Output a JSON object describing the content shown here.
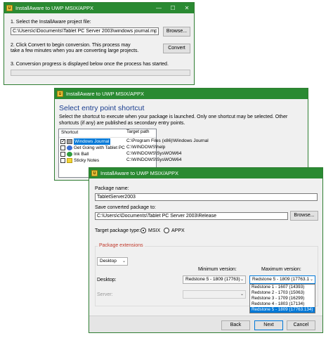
{
  "window1": {
    "title": "InstallAware to UWP MSIX/APPX",
    "step1_label": "1. Select the InstallAware project file:",
    "project_path": "C:\\Users\\c\\Documents\\Tablet PC Server 2003\\windows journal.mpr",
    "browse_label": "Browse...",
    "step2_label_line1": "2. Click Convert to begin conversion. This process may",
    "step2_label_line2": "take a few minutes when you are converting large projects.",
    "convert_label": "Convert",
    "step3_label": "3. Conversion progress is displayed below once the process has started.",
    "progress": 0
  },
  "window2": {
    "title": "InstallAware to UWP MSIX/APPX",
    "heading": "Select entry point shortcut",
    "desc_line1": "Select the shortcut to execute when your package is launched. Only one shortcut may be selected. Other",
    "desc_line2": "shortcuts (if any) are published as secondary entry points.",
    "columns": [
      "Shortcut",
      "Target path"
    ],
    "rows": [
      {
        "name": "Windows Journal",
        "path": "C:\\Program Files (x86)\\Windows Journal",
        "checked": true,
        "selected": true
      },
      {
        "name": "Get Going with Tablet PC",
        "path": "C:\\WINDOWS\\help",
        "checked": false,
        "selected": false
      },
      {
        "name": "Ink Ball",
        "path": "C:\\WINDOWS\\SysWOW64",
        "checked": false,
        "selected": false
      },
      {
        "name": "Sticky Notes",
        "path": "C:\\WINDOWS\\SysWOW64",
        "checked": false,
        "selected": false
      }
    ]
  },
  "window3": {
    "title": "InstallAware to UWP MSIX/APPX",
    "package_name_label": "Package name:",
    "package_name": "TabletServer2003",
    "save_label": "Save converted package to:",
    "save_path": "C:\\Users\\c\\Documents\\Tablet PC Server 2003\\Release",
    "browse_label": "Browse...",
    "target_type_label": "Target package type:",
    "msix_label": "MSIX",
    "appx_label": "APPX",
    "selected_type": "MSIX",
    "extensions_label": "Package extensions",
    "extension_combo": "Desktop",
    "min_version_label": "Minimum version:",
    "max_version_label": "Maximum version:",
    "desktop_label": "Desktop:",
    "desktop_min": "Redstone 5 - 1809 (17763)",
    "desktop_max": "Redstone 5 - 1809 (17763.1",
    "server_label": "Server:",
    "max_options": [
      "Redstone 1 - 1607 (14393)",
      "Redstone 2 - 1703 (15063)",
      "Redstone 3 - 1709 (16299)",
      "Redstone 4 - 1803 (17134)",
      "Redstone 5 - 1809 (17763.134)"
    ],
    "max_selected_index": 4,
    "back_label": "Back",
    "next_label": "Next",
    "cancel_label": "Cancel"
  },
  "colors": {
    "titlebar": "#2a8a32",
    "heading": "#1a3d8f",
    "selection": "#0078d7",
    "group_label": "#c0392b",
    "progress_fill": "#06b025"
  }
}
